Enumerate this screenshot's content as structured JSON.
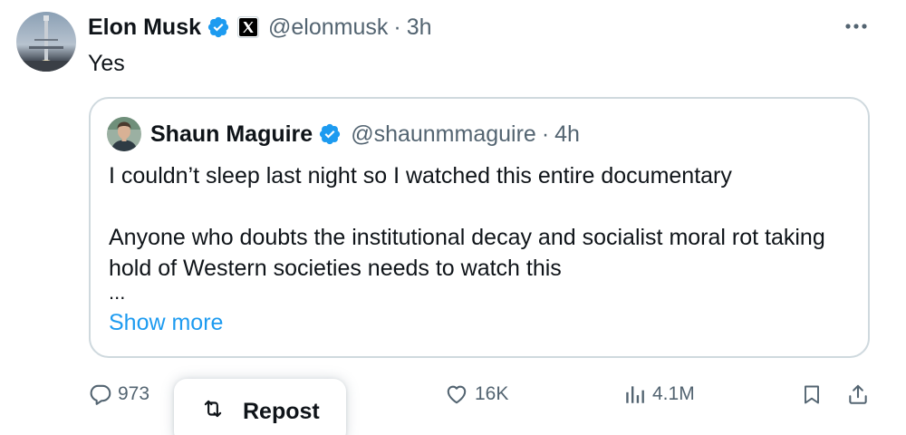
{
  "tweet": {
    "author_name": "Elon Musk",
    "handle": "@elonmusk",
    "separator": "·",
    "time": "3h",
    "text": "Yes",
    "more_icon": "more-icon",
    "verified_icon": "verified-badge-icon",
    "affiliate_icon": "x-logo-icon"
  },
  "quote": {
    "author_name": "Shaun Maguire",
    "handle": "@shaunmmaguire",
    "separator": "·",
    "time": "4h",
    "paragraph1": "I couldn’t sleep last night so I watched this entire documentary",
    "paragraph2": "Anyone who doubts the institutional decay and socialist moral rot taking hold of Western societies needs to watch this",
    "ellipsis": "...",
    "show_more": "Show more"
  },
  "actions": {
    "reply_count": "973",
    "like_count": "16K",
    "views_count": "4.1M",
    "reply_icon": "reply-icon",
    "like_icon": "heart-icon",
    "views_icon": "views-icon",
    "bookmark_icon": "bookmark-icon",
    "share_icon": "share-icon"
  },
  "repost_menu": {
    "label": "Repost",
    "icon": "repost-icon"
  },
  "colors": {
    "accent": "#1d9bf0",
    "text": "#0f1419",
    "secondary": "#536471",
    "border": "#cfd9de"
  }
}
